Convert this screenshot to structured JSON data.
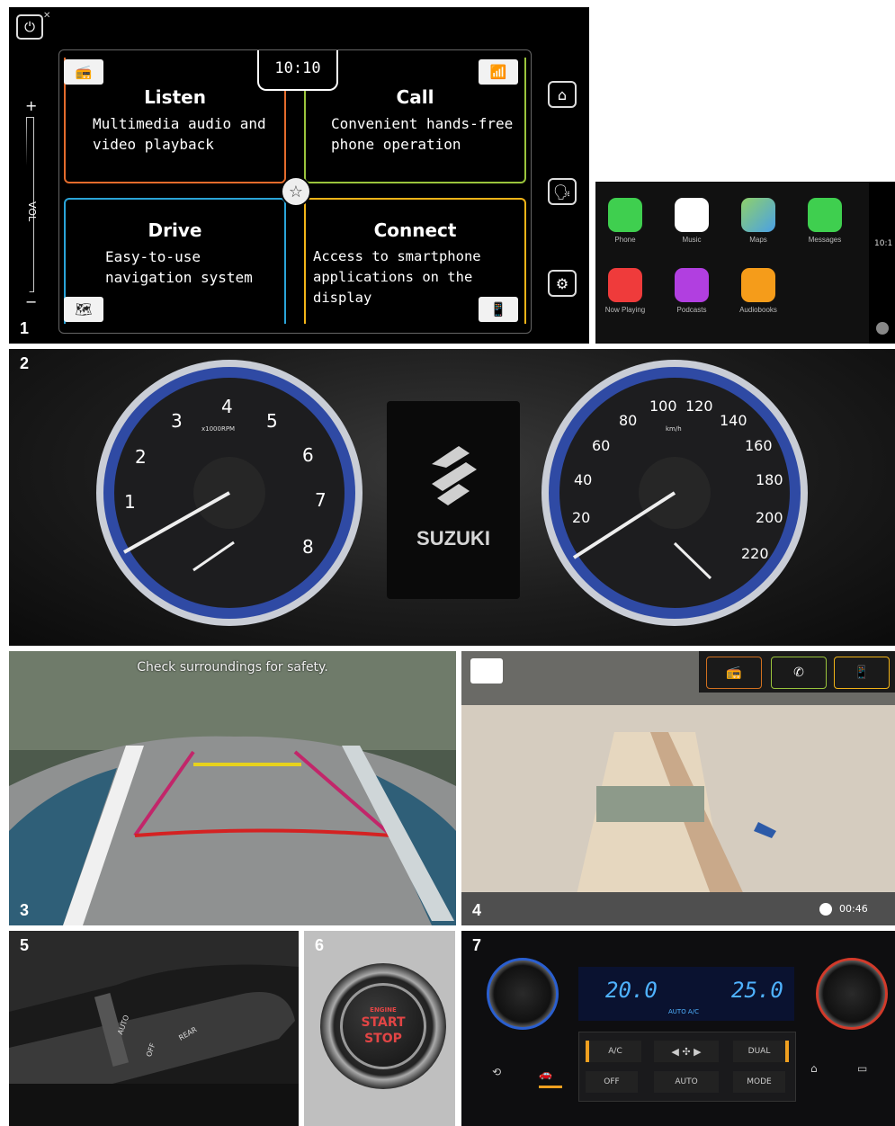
{
  "panels": {
    "p1": "1",
    "p2": "2",
    "p3": "3",
    "p4": "4",
    "p5": "5",
    "p6": "6",
    "p7": "7"
  },
  "infotainment": {
    "clock": "10:10",
    "volume_label": "VOL",
    "vol_plus": "+",
    "vol_minus": "−",
    "quadrants": [
      {
        "title": "Listen",
        "desc_line1": "Multimedia audio and",
        "desc_line2": "video playback",
        "color": "#e36b2c"
      },
      {
        "title": "Call",
        "desc_line1": "Convenient hands-free",
        "desc_line2": "phone operation",
        "color": "#9ac43c"
      },
      {
        "title": "Drive",
        "desc_line1": "Easy-to-use",
        "desc_line2": "navigation system",
        "color": "#2aa4d8"
      },
      {
        "title": "Connect",
        "desc_line1": "Access to smartphone",
        "desc_line2": "applications on the display",
        "color": "#f2b418"
      }
    ],
    "side_buttons": [
      "home-icon",
      "voice-icon",
      "settings-icon"
    ]
  },
  "carplay": {
    "apps": [
      "Phone",
      "Music",
      "Maps",
      "Messages",
      "Now Playing",
      "Podcasts",
      "Audiobooks"
    ],
    "clock": "10:1"
  },
  "cluster": {
    "brand": "SUZUKI",
    "tach_unit": "x1000RPM",
    "tach_ticks": [
      "1",
      "2",
      "3",
      "4",
      "5",
      "6",
      "7",
      "8"
    ],
    "speed_unit": "km/h",
    "speed_ticks": [
      "20",
      "40",
      "60",
      "80",
      "100",
      "120",
      "140",
      "160",
      "180",
      "200",
      "220"
    ]
  },
  "camera": {
    "overlay_text": "Check surroundings for safety."
  },
  "nav": {
    "time": "00:46"
  },
  "climate": {
    "left_temp": "20.0",
    "right_temp": "25.0",
    "mode_label": "AUTO A/C",
    "buttons": [
      "A/C",
      "DUAL",
      "OFF",
      "AUTO",
      "MODE"
    ]
  },
  "start_button": {
    "line1": "ENGINE",
    "line2": "START",
    "line3": "STOP"
  },
  "stalk": {
    "labels": [
      "AUTO",
      "OFF",
      "REAR"
    ]
  }
}
